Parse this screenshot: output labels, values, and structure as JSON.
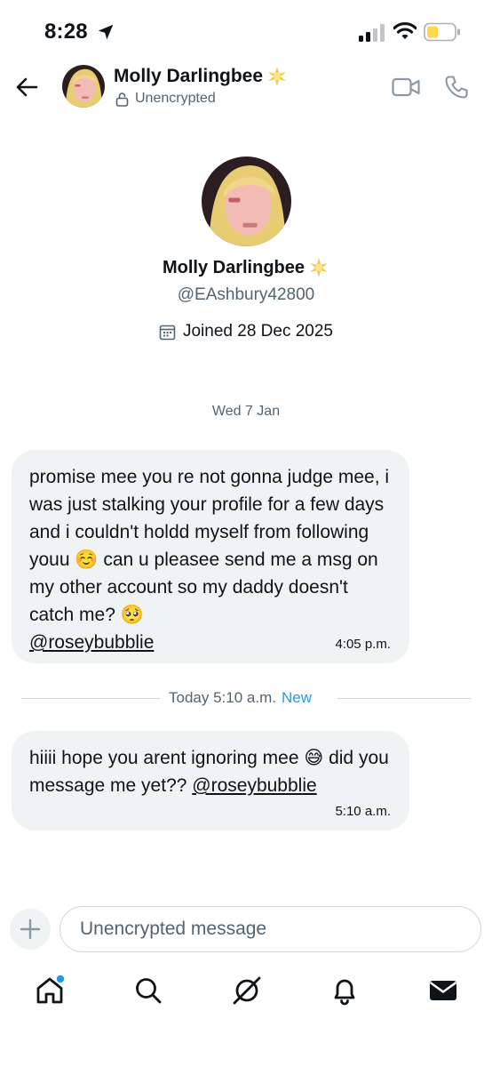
{
  "status_bar": {
    "time": "8:28",
    "icons": [
      "location-arrow-icon",
      "signal-icon",
      "wifi-icon",
      "battery-icon"
    ]
  },
  "header": {
    "name": "Molly Darlingbee",
    "subtitle": "Unencrypted",
    "icons": [
      "back-arrow-icon",
      "verified-star-icon",
      "lock-icon",
      "video-call-icon",
      "phone-call-icon"
    ]
  },
  "profile": {
    "name": "Molly Darlingbee",
    "handle": "@EAshbury42800",
    "joined": "Joined 28 Dec 2025"
  },
  "conversation": {
    "date_separator": "Wed 7 Jan",
    "messages": [
      {
        "text": "promise mee you re not gonna judge mee, i was just stalking your profile for a few days and i couldn't holdd myself from following youu ☺️ can u pleasee send me a msg on my other account so my daddy doesn't catch me? 🥺",
        "mention": "@roseybubblie",
        "time": "4:05 p.m."
      },
      {
        "text": "hiiii hope you arent ignoring mee 😅 did you message me yet??",
        "mention": "@roseybubblie",
        "time": "5:10 a.m."
      }
    ],
    "new_divider": {
      "label": "Today 5:10 a.m.",
      "badge": "New"
    }
  },
  "composer": {
    "placeholder": "Unencrypted message",
    "value": ""
  },
  "tab_bar": {
    "tabs": [
      "home-icon",
      "search-icon",
      "grok-icon",
      "notifications-icon",
      "messages-icon"
    ]
  },
  "colors": {
    "accent": "#1d9bf0",
    "bubble": "#eff3f4",
    "secondary_text": "#536471",
    "primary_text": "#0f1419"
  }
}
